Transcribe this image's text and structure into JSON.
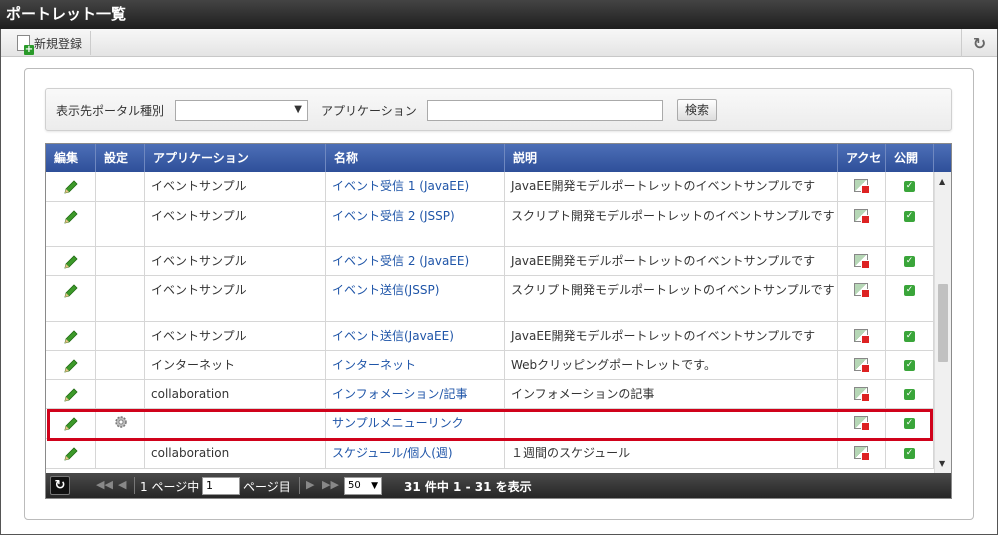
{
  "window": {
    "title": "ポートレット一覧"
  },
  "toolbar": {
    "new_label": "新規登録",
    "refresh_icon": "refresh-icon"
  },
  "search": {
    "portal_type_label": "表示先ポータル種別",
    "portal_type_value": "",
    "application_label": "アプリケーション",
    "application_value": "",
    "search_button": "検索"
  },
  "table": {
    "headers": {
      "edit": "編集",
      "settings": "設定",
      "application": "アプリケーション",
      "name": "名称",
      "description": "説明",
      "access": "アクセ",
      "public": "公開"
    },
    "rows": [
      {
        "application": "イベントサンプル",
        "name": "イベント受信 1 (JavaEE)",
        "description": "JavaEE開発モデルポートレットのイベントサンプルです",
        "has_settings": false
      },
      {
        "application": "イベントサンプル",
        "name": "イベント受信 2 (JSSP)",
        "description": "スクリプト開発モデルポートレットのイベントサンプルです",
        "has_settings": false
      },
      {
        "application": "イベントサンプル",
        "name": "イベント受信 2 (JavaEE)",
        "description": "JavaEE開発モデルポートレットのイベントサンプルです",
        "has_settings": false
      },
      {
        "application": "イベントサンプル",
        "name": "イベント送信(JSSP)",
        "description": "スクリプト開発モデルポートレットのイベントサンプルです",
        "has_settings": false
      },
      {
        "application": "イベントサンプル",
        "name": "イベント送信(JavaEE)",
        "description": "JavaEE開発モデルポートレットのイベントサンプルです",
        "has_settings": false
      },
      {
        "application": "インターネット",
        "name": "インターネット",
        "description": "Webクリッピングポートレットです。",
        "has_settings": false
      },
      {
        "application": "collaboration",
        "name": "インフォメーション/記事",
        "description": "インフォメーションの記事",
        "has_settings": false
      },
      {
        "application": "",
        "name": "サンプルメニューリンク",
        "description": "",
        "has_settings": true
      },
      {
        "application": "collaboration",
        "name": "スケジュール/個人(週)",
        "description": "１週間のスケジュール",
        "has_settings": false
      }
    ]
  },
  "pager": {
    "page_prefix": "1 ページ中",
    "page_value": "1",
    "page_suffix": "ページ目",
    "page_size": "50",
    "summary": "31 件中 1 - 31 を表示"
  },
  "colors": {
    "header_blue": "#3a5ca8",
    "link_blue": "#1f55a8",
    "highlight_red": "#d0021b",
    "check_green": "#3aa53a"
  }
}
